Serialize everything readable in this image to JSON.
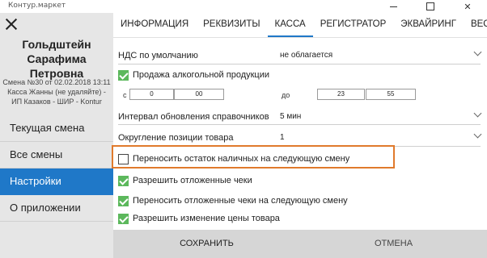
{
  "window": {
    "title": "Контур.маркет"
  },
  "sidebar": {
    "user_name": "Гольдштейн Сарафима Петровна",
    "shift_info": "Смена №30 от 02.02.2018 13:11 Касса Жанны (не удаляйте) - ИП Казаков - ШИР - Kontur",
    "items": [
      {
        "label": "Текущая смена"
      },
      {
        "label": "Все смены"
      },
      {
        "label": "Настройки",
        "active": true
      },
      {
        "label": "О приложении"
      }
    ]
  },
  "tabs": [
    {
      "label": "ИНФОРМАЦИЯ"
    },
    {
      "label": "РЕКВИЗИТЫ"
    },
    {
      "label": "КАССА",
      "active": true
    },
    {
      "label": "РЕГИСТРАТОР"
    },
    {
      "label": "ЭКВАЙРИНГ"
    },
    {
      "label": "ВЕСЫ"
    }
  ],
  "settings": {
    "vat_label": "НДС по умолчанию",
    "vat_value": "не облагается",
    "alcohol_label": "Продажа алкогольной продукции",
    "alcohol_checked": true,
    "time_from_label": "с",
    "time_from_h": "0",
    "time_from_m": "00",
    "time_to_label": "до",
    "time_to_h": "23",
    "time_to_m": "55",
    "refresh_label": "Интервал обновления справочников",
    "refresh_value": "5 мин",
    "rounding_label": "Округление позиции товара",
    "rounding_value": "1",
    "transfer_cash_label": "Переносить остаток наличных на следующую смену",
    "transfer_cash_checked": false,
    "deferred_label": "Разрешить отложенные чеки",
    "deferred_checked": true,
    "transfer_deferred_label": "Переносить отложенные чеки на следующую смену",
    "transfer_deferred_checked": true,
    "price_change_label": "Разрешить изменение цены товара",
    "price_change_checked": true
  },
  "footer": {
    "save_label": "СОХРАНИТЬ",
    "cancel_label": "ОТМЕНА"
  },
  "colors": {
    "accent": "#1f78c8",
    "checkbox": "#5cb85c",
    "highlight": "#e07a2c",
    "sidebar_bg": "#e6e6e6"
  }
}
